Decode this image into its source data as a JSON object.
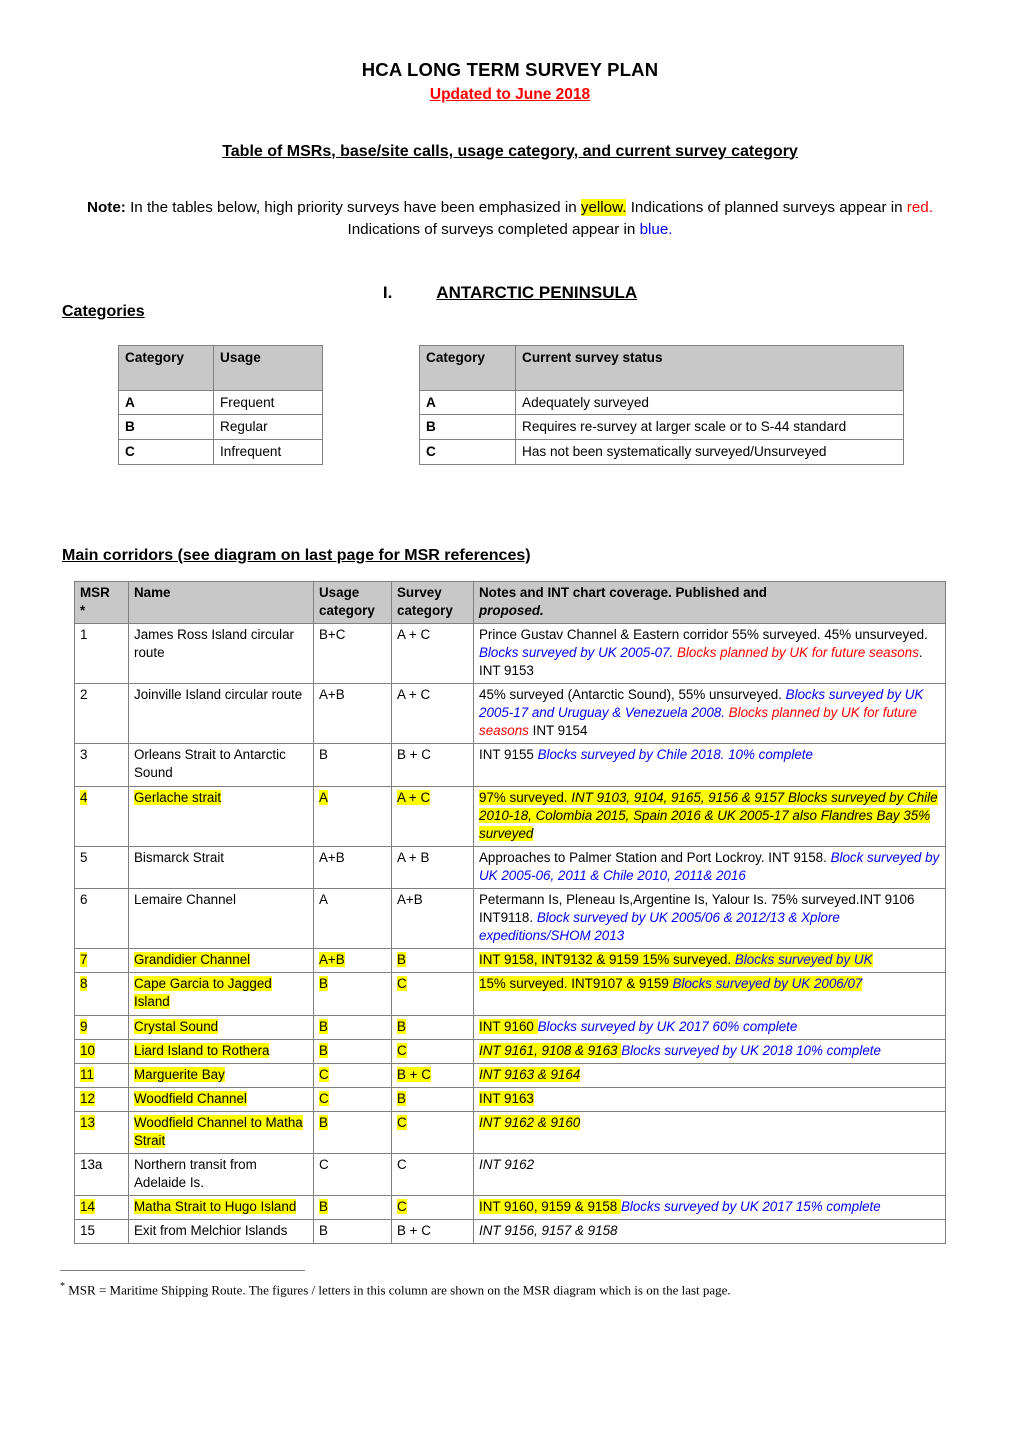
{
  "document": {
    "title": "HCA LONG TERM SURVEY PLAN",
    "subtitle": "Updated to June 2018",
    "table_heading": "Table of MSRs, base/site calls, usage category, and current survey category",
    "note": {
      "label": "Note:",
      "part1": " In the tables below, high priority surveys have been emphasized in ",
      "highlight": "yellow.",
      "part2": " Indications of planned surveys appear in ",
      "red_word": "red.",
      "part3": " Indications of surveys completed appear in ",
      "blue_word": "blue."
    },
    "section": {
      "number": "I.",
      "name": "ANTARCTIC PENINSULA"
    },
    "categories_label": "Categories",
    "corridors_heading": "Main corridors (see diagram on last page for MSR references)",
    "footnote": "MSR = Maritime Shipping Route. The figures / letters in this column are shown on the MSR diagram which is on the last page.",
    "footnote_marker": "*"
  },
  "colors": {
    "highlight": "#ffff00",
    "planned": "#ff0000",
    "completed": "#0000ff",
    "header_fill": "#c8c8c8",
    "border": "#7f7f7f"
  },
  "usage_table": {
    "headers": [
      "Category",
      "Usage"
    ],
    "rows": [
      {
        "category": "A",
        "usage": "Frequent"
      },
      {
        "category": "B",
        "usage": "Regular"
      },
      {
        "category": "C",
        "usage": "Infrequent"
      }
    ]
  },
  "status_table": {
    "headers": [
      "Category",
      "Current survey status"
    ],
    "rows": [
      {
        "category": "A",
        "status": "Adequately surveyed"
      },
      {
        "category": "B",
        "status": "Requires re-survey at larger scale or to S-44 standard"
      },
      {
        "category": "C",
        "status": "Has not been systematically surveyed/Unsurveyed"
      }
    ]
  },
  "main_table": {
    "headers": {
      "msr": "MSR",
      "msr_marker": "*",
      "name": "Name",
      "usage_line1": "Usage",
      "usage_line2": "category",
      "survey_line1": "Survey",
      "survey_line2": "category",
      "notes_line1": "Notes and INT chart coverage. Published and",
      "notes_line2": "proposed."
    },
    "rows": [
      {
        "msr": "1",
        "name": "James Ross Island circular route",
        "usage": "B+C",
        "survey": "A + C",
        "highlight": false,
        "notes": [
          {
            "text": "Prince Gustav Channel & Eastern corridor 55% surveyed. 45% unsurveyed. ",
            "style": "plain"
          },
          {
            "text": "Blocks surveyed by UK 2005-07. ",
            "style": "blue-italic"
          },
          {
            "text": "Blocks planned by UK for future seasons",
            "style": "red-italic"
          },
          {
            "text": ". INT 9153",
            "style": "plain"
          }
        ]
      },
      {
        "msr": "2",
        "name": "Joinville Island circular route",
        "usage": "A+B",
        "survey": "A + C",
        "highlight": false,
        "notes": [
          {
            "text": "45% surveyed (Antarctic Sound), 55% unsurveyed. ",
            "style": "plain"
          },
          {
            "text": "Blocks surveyed by UK  2005-17 and Uruguay & Venezuela  2008. ",
            "style": "blue-italic"
          },
          {
            "text": "Blocks planned by UK for future seasons",
            "style": "red-italic"
          },
          {
            "text": " INT 9154",
            "style": "plain"
          }
        ]
      },
      {
        "msr": "3",
        "name": "Orleans Strait to Antarctic Sound",
        "usage": "B",
        "survey": "B + C",
        "highlight": false,
        "notes": [
          {
            "text": "INT 9155 ",
            "style": "plain"
          },
          {
            "text": "Blocks surveyed by Chile 2018. 10% complete",
            "style": "blue-italic"
          }
        ]
      },
      {
        "msr": "4",
        "name": "Gerlache strait",
        "usage": "A",
        "survey": "A + C",
        "highlight": true,
        "notes": [
          {
            "text": "97% surveyed. ",
            "style": "plain-hl"
          },
          {
            "text": "INT 9103, 9104, 9165, 9156 & 9157 Blocks surveyed by Chile 2010-18, Colombia 2015, Spain 2016 & UK 2005-17 also Flandres Bay 35% surveyed",
            "style": "italic-hl"
          }
        ]
      },
      {
        "msr": "5",
        "name": "Bismarck Strait",
        "usage": "A+B",
        "survey": "A + B",
        "highlight": false,
        "notes": [
          {
            "text": "Approaches to Palmer Station and Port Lockroy. INT 9158. ",
            "style": "plain"
          },
          {
            "text": "Block surveyed by UK 2005-06, 2011 & Chile 2010, 2011& 2016",
            "style": "blue-italic"
          }
        ]
      },
      {
        "msr": "6",
        "name": "Lemaire Channel",
        "usage": "A",
        "survey": "A+B",
        "highlight": false,
        "notes": [
          {
            "text": "Petermann Is, Pleneau Is,Argentine Is, Yalour Is. 75% surveyed.INT 9106 INT9118. ",
            "style": "plain"
          },
          {
            "text": "Block surveyed by UK 2005/06 & 2012/13 & Xplore expeditions/SHOM 2013",
            "style": "blue-italic"
          }
        ]
      },
      {
        "msr": "7",
        "name": "Grandidier Channel",
        "usage": "A+B",
        "survey": "B",
        "highlight": true,
        "notes": [
          {
            "text": "INT 9158, INT9132 & 9159 15% surveyed. ",
            "style": "plain-hl"
          },
          {
            "text": "Blocks surveyed by UK",
            "style": "blue-italic-hl"
          }
        ]
      },
      {
        "msr": "8",
        "name": "Cape Garcia to Jagged Island",
        "usage": "B",
        "survey": "C",
        "highlight": true,
        "notes": [
          {
            "text": "15% surveyed. INT9107 & 9159 ",
            "style": "plain-hl"
          },
          {
            "text": "Blocks surveyed by UK 2006/07",
            "style": "blue-italic-hl"
          }
        ]
      },
      {
        "msr": "9",
        "name": "Crystal Sound",
        "usage": "B",
        "survey": "B",
        "highlight": true,
        "notes": [
          {
            "text": "INT 9160 ",
            "style": "plain-hl"
          },
          {
            "text": "Blocks surveyed by UK 2017 60% complete",
            "style": "blue-italic"
          }
        ]
      },
      {
        "msr": "10",
        "name": "Liard Island to Rothera",
        "usage": "B",
        "survey": "C",
        "highlight": true,
        "notes": [
          {
            "text": "INT 9161, 9108 & 9163 ",
            "style": "italic-hl"
          },
          {
            "text": "Blocks surveyed by UK 2018 10% complete",
            "style": "blue-italic"
          }
        ]
      },
      {
        "msr": "11",
        "name": "Marguerite Bay",
        "usage": "C",
        "survey": "B + C",
        "highlight": true,
        "notes": [
          {
            "text": "INT 9163 & 9164",
            "style": "italic-hl"
          }
        ]
      },
      {
        "msr": "12",
        "name": "Woodfield Channel",
        "usage": "C",
        "survey": "B",
        "highlight": true,
        "notes": [
          {
            "text": "INT 9163",
            "style": "plain-hl"
          }
        ]
      },
      {
        "msr": "13",
        "name": "Woodfield Channel to Matha Strait",
        "usage": "B",
        "survey": "C",
        "highlight": true,
        "notes": [
          {
            "text": "INT 9162 & 9160",
            "style": "italic-hl"
          }
        ]
      },
      {
        "msr": "13a",
        "name": "Northern transit from Adelaide Is.",
        "usage": "C",
        "survey": "C",
        "highlight": false,
        "notes": [
          {
            "text": "INT 9162",
            "style": "italic"
          }
        ]
      },
      {
        "msr": "14",
        "name": "Matha Strait to Hugo Island",
        "usage": "B",
        "survey": "C",
        "highlight": true,
        "notes": [
          {
            "text": "INT 9160, 9159 & 9158 ",
            "style": "plain-hl"
          },
          {
            "text": "Blocks surveyed by UK 2017 15% complete",
            "style": "blue-italic"
          }
        ]
      },
      {
        "msr": "15",
        "name": "Exit from Melchior Islands",
        "usage": "B",
        "survey": "B + C",
        "highlight": false,
        "notes": [
          {
            "text": "INT 9156, 9157 & 9158",
            "style": "italic"
          }
        ]
      }
    ]
  }
}
